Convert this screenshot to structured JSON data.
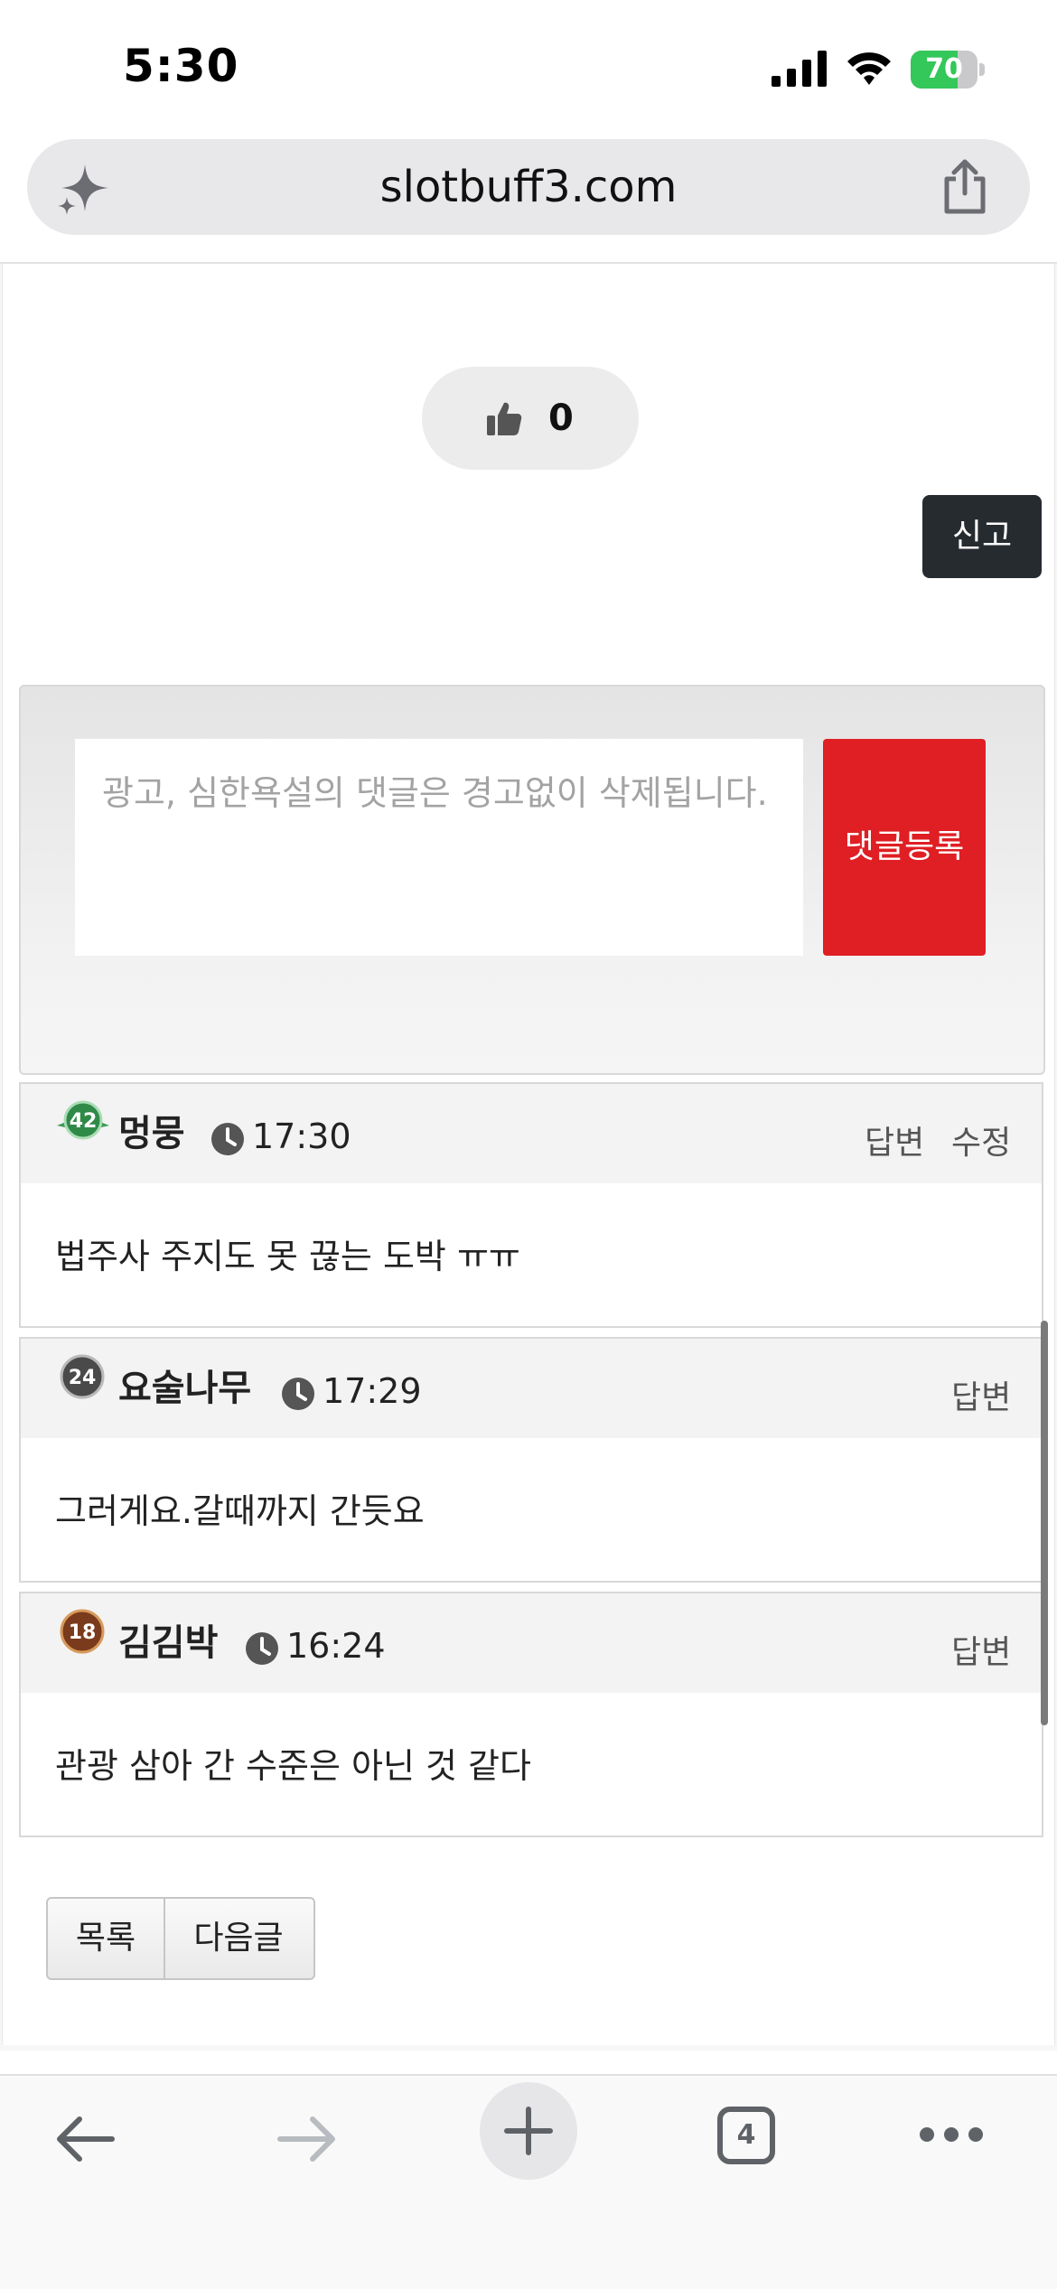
{
  "status_bar": {
    "time": "5:30",
    "battery_text": "70",
    "battery_level": 0.7,
    "icons": [
      "signal-icon",
      "wifi-icon",
      "battery-charging-icon"
    ]
  },
  "browser": {
    "url": "slotbuff3.com",
    "icons": [
      "sparkle-icon",
      "share-icon"
    ],
    "toolbar": {
      "tab_count": "4",
      "icons": [
        "back-arrow-icon",
        "forward-arrow-icon",
        "plus-icon",
        "tabs-icon",
        "more-icon"
      ]
    }
  },
  "post": {
    "like_count": "0",
    "report_label": "신고"
  },
  "comment_form": {
    "placeholder": "광고, 심한욕설의 댓글은 경고없이 삭제됩니다.",
    "submit_label": "댓글등록"
  },
  "comments": [
    {
      "level": "42",
      "author": "멍뭉",
      "time": "17:30",
      "actions": [
        "답변",
        "수정"
      ],
      "body": "법주사 주지도 못 끊는 도박 ㅠㅠ"
    },
    {
      "level": "24",
      "author": "요술나무",
      "time": "17:29",
      "actions": [
        "답변"
      ],
      "body": "그러게요.갈때까지 간듯요"
    },
    {
      "level": "18",
      "author": "김김박",
      "time": "16:24",
      "actions": [
        "답변"
      ],
      "body": "관광 삼아 간 수준은 아닌 것 같다"
    }
  ],
  "navigation": {
    "list_label": "목록",
    "next_label": "다음글"
  },
  "colors": {
    "submit_red": "#df1f24",
    "report_dark": "#262b30",
    "battery_green": "#34c759"
  }
}
